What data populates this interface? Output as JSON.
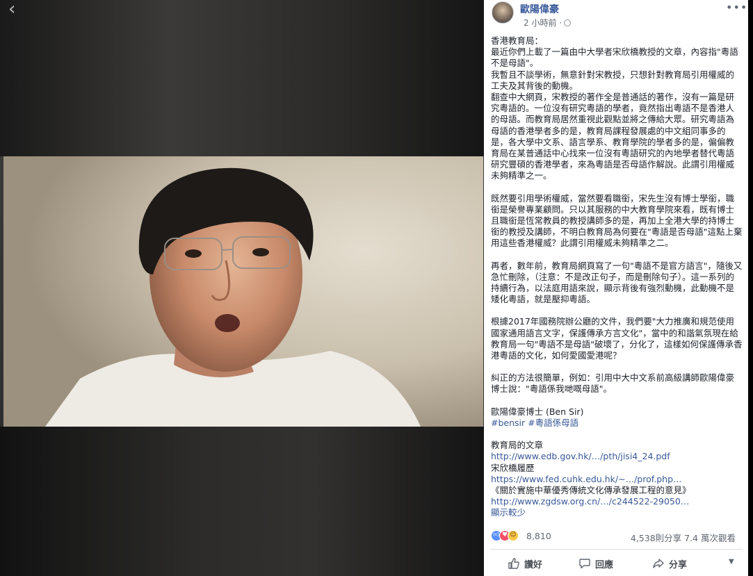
{
  "viewer": {
    "back_icon": "chevron-left-icon",
    "video_description_icon": "video-frame"
  },
  "post": {
    "author": "歐陽偉豪",
    "timestamp": "2 小時前 ·",
    "privacy_icon": "globe-icon",
    "more_icon": "ellipsis-icon",
    "paragraphs": [
      [
        "香港教育局：",
        "最近你們上載了一篇由中大學者宋欣橋教授的文章，內容指\"粵語不是母語\"。",
        "我暫且不談學術，無意針對宋教授，只想針對教育局引用權威的工夫及其背後的動機。",
        "翻查中大網頁，宋教授的著作全是普通話的著作，沒有一篇是研究粵語的。一位沒有研究粵語的學者，竟然指出粵語不是香港人的母語。而教育局居然重視此觀點並將之傳給大眾。研究粵語為母語的香港學者多的是，教育局課程發展處的中文組同事多的是，各大學中文系、語言學系、教育學院的學者多的是，偏偏教育局在某普通話中心找來一位沒有粵語研究的內地學者替代粵語研究豐碩的香港學者，來為粵語是否母語作解說。此謂引用權威未夠精準之一。"
      ],
      [
        "既然要引用學術權威，當然要看職銜，宋先生沒有博士學銜，職銜是榮譽專業顧問。只以其服務的中大教育學院來看，既有博士且職銜是恆常教員的教授講師多的是，再加上全港大學的持博士銜的教授及講師，不明白教育局為何要在\"粵語是否母語\"這點上棄用這些香港權威？此謂引用權威未夠精準之二。"
      ],
      [
        "再者，數年前，教育局網頁寫了一句\"粵語不是官方語言\"，隨後又急忙刪除，（注意：不是改正句子，而是刪除句子）。這一系列的持續行為，以法庭用語來說，顯示背後有強烈動機，此動機不是矮化粵語，就是壓抑粵語。"
      ],
      [
        "根據2017年國務院辦公廳的文件，我們要\"大力推廣和規范使用國家通用語言文字，保護傳承方言文化\"，當中的和諧氣氛現在給教育局一句\"粵語不是母語\"破壞了，分化了，這樣如何保護傳承香港粵語的文化，如何愛國愛港呢？"
      ],
      [
        "糾正的方法很簡單，例如：引用中大中文系前高級講師歐陽偉豪博士說：\"粵語係我哋嘅母語\"。"
      ],
      [
        "歐陽偉豪博士 (Ben Sir)",
        "#bensir #粵語係母語"
      ]
    ],
    "links_heading": "教育局的文章",
    "link1": "http://www.edb.gov.hk/…/pth/jisi4_24.pdf",
    "link2_label": "宋欣橋履歷",
    "link2": "https://www.fed.cuhk.edu.hk/~…/prof.php…",
    "link3_label": "《關於實施中華優秀傳統文化傳承發展工程的意見》",
    "link3": "http://www.zgdsw.org.cn/…/c244522-29050…",
    "see_less": "顯示較少"
  },
  "stats": {
    "reaction_icons": [
      "like-icon",
      "love-icon",
      "haha-icon"
    ],
    "reaction_count": "8,810",
    "shares_views": "4,538則分享  7.4 萬次觀看"
  },
  "actions": {
    "like": "讚好",
    "comment": "回應",
    "share": "分享",
    "audience_caret_icon": "caret-down-icon"
  },
  "colors": {
    "link": "#385898",
    "author": "#365899",
    "body_text": "#1d2129",
    "meta_text": "#616770"
  }
}
